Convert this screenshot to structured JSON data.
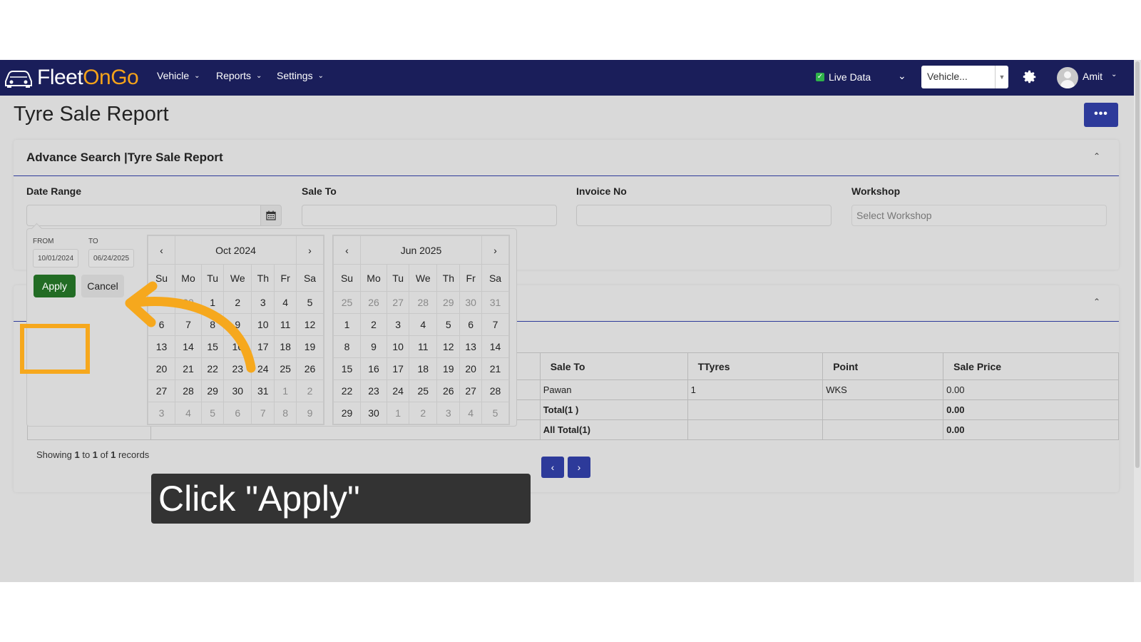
{
  "navbar": {
    "logo_prefix": "Fleet",
    "logo_accent": "OnGo",
    "menus": [
      {
        "label": "Vehicle"
      },
      {
        "label": "Reports"
      },
      {
        "label": "Settings"
      }
    ],
    "live_data_label": "Live Data",
    "vehicle_select_value": "Vehicle...",
    "user_name": "Amit"
  },
  "page": {
    "title": "Tyre Sale Report",
    "more_label": "•••"
  },
  "search": {
    "title": "Advance Search |Tyre Sale Report",
    "fields": {
      "date_range_label": "Date Range",
      "sale_to_label": "Sale To",
      "invoice_no_label": "Invoice No",
      "workshop_label": "Workshop",
      "workshop_placeholder": "Select Workshop"
    }
  },
  "date_picker": {
    "from_label": "FROM",
    "to_label": "TO",
    "from_value": "10/01/2024",
    "to_value": "06/24/2025",
    "apply_label": "Apply",
    "cancel_label": "Cancel",
    "day_names": [
      "Su",
      "Mo",
      "Tu",
      "We",
      "Th",
      "Fr",
      "Sa"
    ],
    "left": {
      "month": "Oct 2024",
      "weeks": [
        [
          {
            "d": "29",
            "off": true
          },
          {
            "d": "30",
            "off": true
          },
          {
            "d": "1",
            "off": false
          },
          {
            "d": "2",
            "off": false
          },
          {
            "d": "3",
            "off": false
          },
          {
            "d": "4",
            "off": false
          },
          {
            "d": "5",
            "off": false
          }
        ],
        [
          {
            "d": "6",
            "off": false
          },
          {
            "d": "7",
            "off": false
          },
          {
            "d": "8",
            "off": false
          },
          {
            "d": "9",
            "off": false
          },
          {
            "d": "10",
            "off": false
          },
          {
            "d": "11",
            "off": false
          },
          {
            "d": "12",
            "off": false
          }
        ],
        [
          {
            "d": "13",
            "off": false
          },
          {
            "d": "14",
            "off": false
          },
          {
            "d": "15",
            "off": false
          },
          {
            "d": "16",
            "off": false
          },
          {
            "d": "17",
            "off": false
          },
          {
            "d": "18",
            "off": false
          },
          {
            "d": "19",
            "off": false
          }
        ],
        [
          {
            "d": "20",
            "off": false
          },
          {
            "d": "21",
            "off": false
          },
          {
            "d": "22",
            "off": false
          },
          {
            "d": "23",
            "off": false
          },
          {
            "d": "24",
            "off": false
          },
          {
            "d": "25",
            "off": false
          },
          {
            "d": "26",
            "off": false
          }
        ],
        [
          {
            "d": "27",
            "off": false
          },
          {
            "d": "28",
            "off": false
          },
          {
            "d": "29",
            "off": false
          },
          {
            "d": "30",
            "off": false
          },
          {
            "d": "31",
            "off": false
          },
          {
            "d": "1",
            "off": true
          },
          {
            "d": "2",
            "off": true
          }
        ],
        [
          {
            "d": "3",
            "off": true
          },
          {
            "d": "4",
            "off": true
          },
          {
            "d": "5",
            "off": true
          },
          {
            "d": "6",
            "off": true
          },
          {
            "d": "7",
            "off": true
          },
          {
            "d": "8",
            "off": true
          },
          {
            "d": "9",
            "off": true
          }
        ]
      ]
    },
    "right": {
      "month": "Jun 2025",
      "weeks": [
        [
          {
            "d": "25",
            "off": true
          },
          {
            "d": "26",
            "off": true
          },
          {
            "d": "27",
            "off": true
          },
          {
            "d": "28",
            "off": true
          },
          {
            "d": "29",
            "off": true
          },
          {
            "d": "30",
            "off": true
          },
          {
            "d": "31",
            "off": true
          }
        ],
        [
          {
            "d": "1",
            "off": false
          },
          {
            "d": "2",
            "off": false
          },
          {
            "d": "3",
            "off": false
          },
          {
            "d": "4",
            "off": false
          },
          {
            "d": "5",
            "off": false
          },
          {
            "d": "6",
            "off": false
          },
          {
            "d": "7",
            "off": false
          }
        ],
        [
          {
            "d": "8",
            "off": false
          },
          {
            "d": "9",
            "off": false
          },
          {
            "d": "10",
            "off": false
          },
          {
            "d": "11",
            "off": false
          },
          {
            "d": "12",
            "off": false
          },
          {
            "d": "13",
            "off": false
          },
          {
            "d": "14",
            "off": false
          }
        ],
        [
          {
            "d": "15",
            "off": false
          },
          {
            "d": "16",
            "off": false
          },
          {
            "d": "17",
            "off": false
          },
          {
            "d": "18",
            "off": false
          },
          {
            "d": "19",
            "off": false
          },
          {
            "d": "20",
            "off": false
          },
          {
            "d": "21",
            "off": false
          }
        ],
        [
          {
            "d": "22",
            "off": false
          },
          {
            "d": "23",
            "off": false
          },
          {
            "d": "24",
            "off": false
          },
          {
            "d": "25",
            "off": false
          },
          {
            "d": "26",
            "off": false
          },
          {
            "d": "27",
            "off": false
          },
          {
            "d": "28",
            "off": false
          }
        ],
        [
          {
            "d": "29",
            "off": false
          },
          {
            "d": "30",
            "off": false
          },
          {
            "d": "1",
            "off": true
          },
          {
            "d": "2",
            "off": true
          },
          {
            "d": "3",
            "off": true
          },
          {
            "d": "4",
            "off": true
          },
          {
            "d": "5",
            "off": true
          }
        ]
      ]
    }
  },
  "table": {
    "headers": [
      "Sale To",
      "TTyres",
      "Point",
      "Sale Price"
    ],
    "rows": [
      [
        "Pawan",
        "1",
        "WKS",
        "0.00"
      ],
      [
        "Total(1 )",
        "",
        "",
        "0.00"
      ],
      [
        "All Total(1)",
        "",
        "",
        "0.00"
      ]
    ]
  },
  "pagination": {
    "showing_prefix": "Showing ",
    "from": "1",
    "to_word": " to ",
    "to": "1",
    "of_word": " of ",
    "total": "1",
    "suffix": " records",
    "prev": "‹",
    "next": "›"
  },
  "callout": {
    "text": "Click \"Apply\""
  },
  "colors": {
    "navbar": "#1a1e5a",
    "logo_accent": "#f4a21a",
    "primary": "#2d3a9a",
    "apply": "#226c24",
    "highlight": "#f6a81d"
  }
}
